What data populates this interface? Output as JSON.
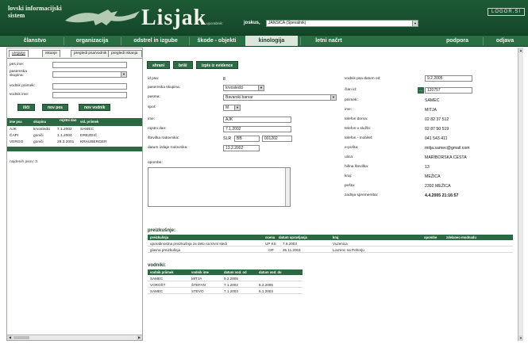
{
  "header": {
    "system_title": "lovski informacijski sistem",
    "brand": "Lisjak",
    "user_label": "uporabnik:",
    "user_name": "joskus,",
    "user_select": "JANSICA (Spevalnik)",
    "logout_label": "LOGOR.SI"
  },
  "main_nav": [
    {
      "label": "članstvo"
    },
    {
      "label": "organizacija"
    },
    {
      "label": "odstrel in izgube"
    },
    {
      "label": "škode - objekti"
    },
    {
      "label": "kinologija"
    },
    {
      "label": "letni načrt"
    },
    {
      "label": "podpora"
    },
    {
      "label": "odjava"
    }
  ],
  "sidebar": {
    "tabs": [
      "urejanje",
      "iskanje",
      "pregledi psa/vodnik",
      "pregledi iskanja"
    ],
    "fields": [
      {
        "label": "pes ime:"
      },
      {
        "label": "pasemska skupina:"
      },
      {
        "label": "vodnik priimek:"
      },
      {
        "label": "vodnik ime:"
      }
    ],
    "buttons": {
      "search": "išči",
      "new_dog": "nov pes",
      "new_handler": "nov vodnik"
    },
    "table": {
      "headers": [
        "ime psa",
        "skupina",
        "rojstni dan",
        "vid. priimek"
      ],
      "rows": [
        [
          "AJK",
          "krvosledci",
          "7.1.2002",
          "SAMEC"
        ],
        [
          "ČAPI",
          "goniči",
          "1.1.2004",
          "DREZDIČ"
        ],
        [
          "VERGO",
          "goniči",
          "28.3.2001",
          "KRAUBERGER"
        ]
      ],
      "found": "najdenih psov: 3."
    }
  },
  "content": {
    "actions": {
      "save": "shrani",
      "delete": "briši",
      "remove": "izpis iz evidence"
    },
    "left_fields": [
      {
        "label": "id psa:",
        "value": "8"
      },
      {
        "label": "pasemska skupina:",
        "value": "krvosledci"
      },
      {
        "label": "pasma:",
        "value": "Bavarski barvar"
      },
      {
        "label": "spol:",
        "value": "M"
      },
      {
        "label": "ime:",
        "value": "AJK"
      },
      {
        "label": "rojstni dan:",
        "value": "7.1.2002"
      },
      {
        "label": "številka rodovnika:",
        "value": "SLR",
        "value2": "BB",
        "value3": "001202"
      },
      {
        "label": "datum izdaje rodovnika:",
        "value": "13.2.2002"
      },
      {
        "label": "opombe:",
        "value": ""
      }
    ],
    "right_fields": [
      {
        "label": "vodnik psa datum od:",
        "value": "9.2.2005"
      },
      {
        "label": "član id:",
        "value": "120757"
      },
      {
        "label": "priimek:",
        "value": "SAMEC"
      },
      {
        "label": "ime:",
        "value": "MITJA"
      },
      {
        "label": "telefon doma:",
        "value": "02 82 37 512"
      },
      {
        "label": "telefon v službi:",
        "value": "02 87 50 519"
      },
      {
        "label": "telefon - mobitel:",
        "value": "041 543 411"
      },
      {
        "label": "e-pošta:",
        "value": "mitja.samec@gmail.com"
      },
      {
        "label": "ulica:",
        "value": "MARIBORSKA CESTA"
      },
      {
        "label": "hišna številka:",
        "value": "13"
      },
      {
        "label": "kraj:",
        "value": "MEŽICA"
      },
      {
        "label": "pošta:",
        "value": "2392 MEŽICA"
      },
      {
        "label": "zadnja sprememba:",
        "value": "4.4.2005 21:16:57"
      }
    ],
    "tests": {
      "title": "preizkušnje:",
      "headers": [
        "preizkušnja",
        "ocena",
        "datum opravljanja",
        "kraj",
        "opombe",
        "zdelanec-modnadu"
      ],
      "rows": [
        [
          "uporabnostna preizkušnja za delo na krvni sledi",
          "UP KS",
          "7.6.2003",
          "Vuzenica",
          "",
          ""
        ],
        [
          "glavna preizkušnja",
          "OP",
          "25.11.2004",
          "Lovrenc na Pohorju",
          "",
          ""
        ]
      ]
    },
    "handlers": {
      "title": "vodniki:",
      "headers": [
        "vodnik priimek",
        "vodnik ime",
        "datum vod. od",
        "datum vod. do"
      ],
      "rows": [
        [
          "SAMEC",
          "MITJA",
          "9.2.2005",
          ""
        ],
        [
          "VOROŠT",
          "ŠTEFAN",
          "7.1.2002",
          "8.2.2005"
        ],
        [
          "SAMEC",
          "STEVO",
          "7.1.2003",
          "6.1.2003"
        ]
      ]
    }
  },
  "colors": {
    "header_green": "#1e5a35",
    "nav_green": "#2a6e44",
    "table_head": "#2c6842",
    "active_tab": "#dde6dc"
  }
}
